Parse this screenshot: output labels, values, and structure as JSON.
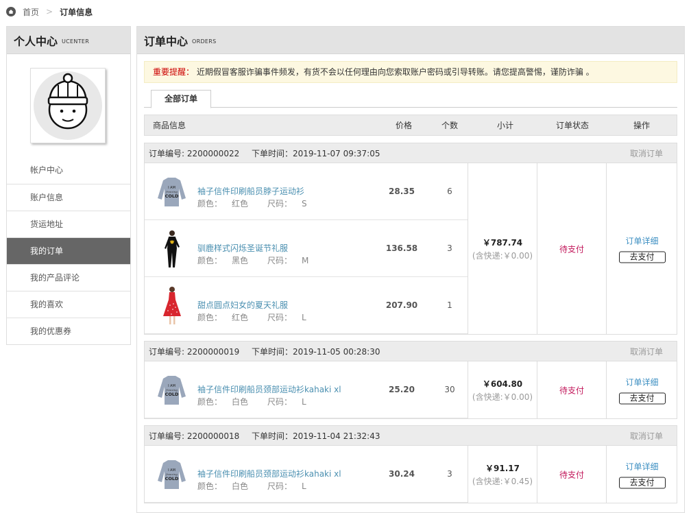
{
  "breadcrumb": {
    "home": "首页",
    "sep": ">",
    "current": "订单信息"
  },
  "sidebar": {
    "title": "个人中心",
    "subtitle": "UCENTER",
    "items": [
      {
        "label": "帐户中心"
      },
      {
        "label": "账户信息"
      },
      {
        "label": "货运地址"
      },
      {
        "label": "我的订单",
        "active": true
      },
      {
        "label": "我的产品评论"
      },
      {
        "label": "我的喜欢"
      },
      {
        "label": "我的优惠券"
      }
    ]
  },
  "main": {
    "title": "订单中心",
    "subtitle": "ORDERS",
    "notice_label": "重要提醒：",
    "notice_text": "近期假冒客服诈骗事件频发，有货不会以任何理由向您索取账户密码或引导转账。请您提高警惕，谨防诈骗 。",
    "tab": "全部订单",
    "columns": {
      "info": "商品信息",
      "price": "价格",
      "qty": "个数",
      "subtotal": "小计",
      "status": "订单状态",
      "op": "操作"
    }
  },
  "labels": {
    "order_no": "订单编号:",
    "order_time": "下单时间：",
    "cancel": "取消订单",
    "color": "颜色：",
    "size": "尺码：",
    "detail": "订单详细",
    "pay": "去支付"
  },
  "orders": [
    {
      "no": "2200000022",
      "time": "2019-11-07 09:37:05",
      "total": "￥787.74",
      "shipping": "(含快递:￥0.00)",
      "status": "待支付",
      "items": [
        {
          "name": "袖子信件印刷船员脖子运动衫",
          "color": "红色",
          "size": "S",
          "price": "28.35",
          "qty": "6",
          "image": "sweatshirt"
        },
        {
          "name": "驯鹿样式闪烁圣诞节礼服",
          "color": "黑色",
          "size": "M",
          "price": "136.58",
          "qty": "3",
          "image": "black-dress"
        },
        {
          "name": "甜点圆点妇女的夏天礼服",
          "color": "红色",
          "size": "L",
          "price": "207.90",
          "qty": "1",
          "image": "red-dress"
        }
      ]
    },
    {
      "no": "2200000019",
      "time": "2019-11-05 00:28:30",
      "total": "￥604.80",
      "shipping": "(含快递:￥0.00)",
      "status": "待支付",
      "items": [
        {
          "name": "袖子信件印刷船员颈部运动衫kahaki xl",
          "color": "白色",
          "size": "L",
          "price": "25.20",
          "qty": "30",
          "image": "sweatshirt"
        }
      ]
    },
    {
      "no": "2200000018",
      "time": "2019-11-04 21:32:43",
      "total": "￥91.17",
      "shipping": "(含快递:￥0.45)",
      "status": "待支付",
      "items": [
        {
          "name": "袖子信件印刷船员颈部运动衫kahaki xl",
          "color": "白色",
          "size": "L",
          "price": "30.24",
          "qty": "3",
          "image": "sweatshirt"
        }
      ]
    }
  ]
}
